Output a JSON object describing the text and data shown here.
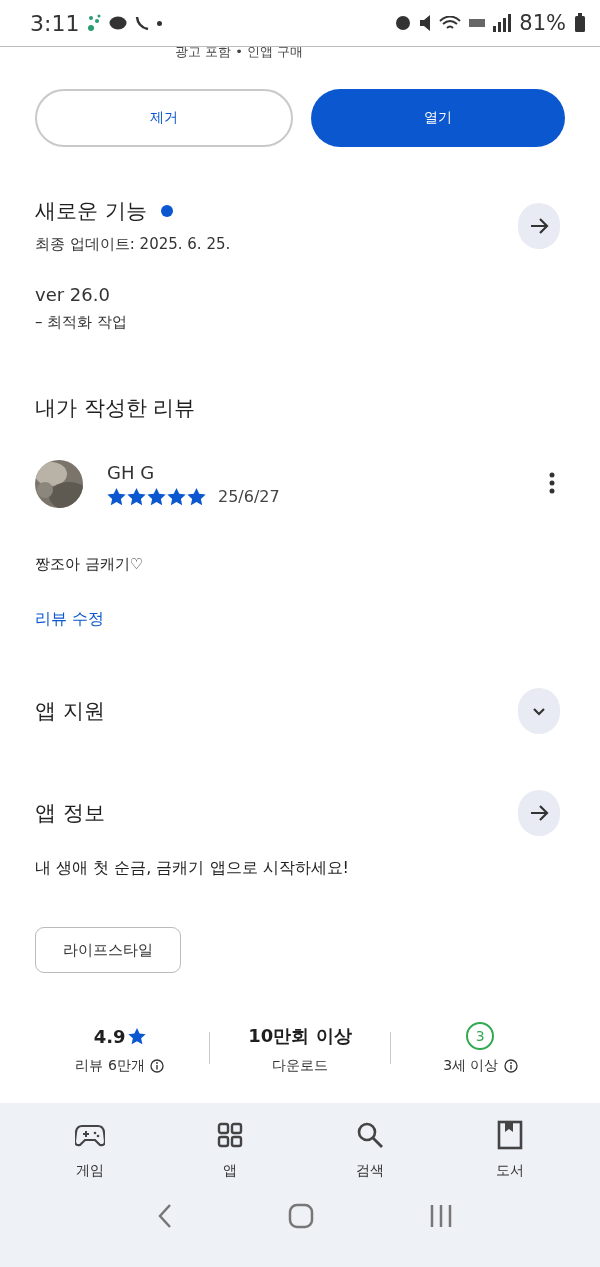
{
  "status_bar": {
    "time": "3:11",
    "battery": "81%"
  },
  "app_meta": "광고 포함 • 인앱 구매",
  "actions": [
    {
      "label": "제거",
      "kind": "outline"
    },
    {
      "label": "열기",
      "kind": "filled"
    }
  ],
  "whats_new": {
    "title": "새로운 기능",
    "new_dot": true,
    "updated": "최종 업데이트: 2025. 6. 25.",
    "version": "ver 26.0",
    "notes": "– 최적화 작업"
  },
  "my_review": {
    "heading": "내가 작성한 리뷰",
    "author": "GH G",
    "stars": 5,
    "date": "25/6/27",
    "text": "짱조아 금캐기♡",
    "edit_link": "리뷰 수정"
  },
  "sections": [
    {
      "title": "앱 지원",
      "kind": "expand"
    },
    {
      "title": "앱 정보",
      "kind": "arrow"
    }
  ],
  "description": "내 생애 첫 순금, 금캐기 앱으로 시작하세요!",
  "category_chip": "라이프스타일",
  "stats": [
    {
      "kind": "rating",
      "value": "4.9",
      "label": "리뷰 6만개",
      "info": true
    },
    {
      "kind": "downloads",
      "value": "10만회 이상",
      "label": "다운로드",
      "info": false
    },
    {
      "kind": "age",
      "value": "3",
      "label": "3세 이상",
      "info": true
    }
  ],
  "bottom_nav": [
    {
      "label": "게임",
      "kind": "games",
      "selected": false
    },
    {
      "label": "앱",
      "kind": "apps",
      "selected": false
    },
    {
      "label": "검색",
      "kind": "search",
      "selected": false
    },
    {
      "label": "도서",
      "kind": "books",
      "selected": false
    }
  ]
}
